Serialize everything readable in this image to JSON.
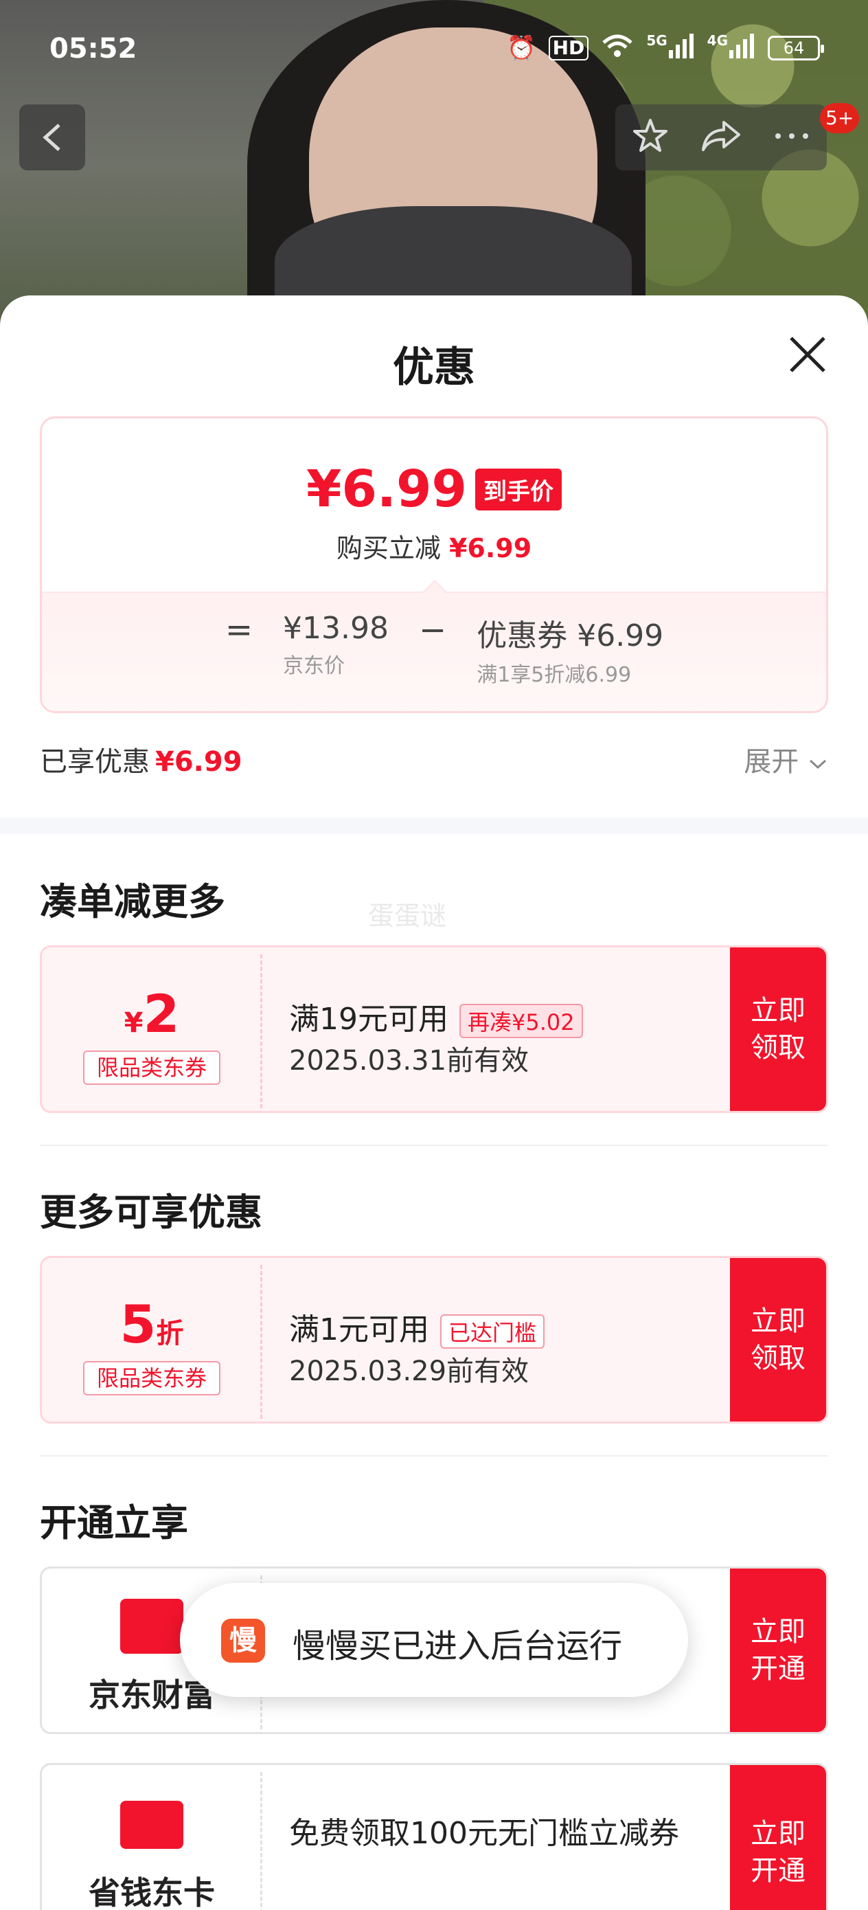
{
  "status_bar": {
    "time": "05:52",
    "hd_label": "HD",
    "net_5g": "5G",
    "net_4g": "4G",
    "battery": "64"
  },
  "nav": {
    "badge": "5+"
  },
  "sheet": {
    "title": "优惠",
    "price_summary": {
      "final_price": "¥6.99",
      "final_price_tag": "到手价",
      "subline_prefix": "购买立减",
      "subline_amount": "¥6.99",
      "equals": "=",
      "jd_price": "¥13.98",
      "jd_price_label": "京东价",
      "minus": "−",
      "coupon_text": "优惠券 ¥6.99",
      "coupon_rule": "满1享5折减6.99"
    },
    "saved_label": "已享优惠",
    "saved_amount": "¥6.99",
    "expand_label": "展开",
    "watermark": "蛋蛋谜"
  },
  "section_more": {
    "title": "凑单减更多",
    "coupon": {
      "symbol": "¥",
      "amount": "2",
      "tag": "限品类东券",
      "condition": "满19元可用",
      "pill": "再凑¥5.02",
      "valid": "2025.03.31前有效",
      "cta_line1": "立即",
      "cta_line2": "领取"
    }
  },
  "section_enjoy": {
    "title": "更多可享优惠",
    "coupon": {
      "amount": "5",
      "unit": "折",
      "tag": "限品类东券",
      "condition": "满1元可用",
      "pill": "已达门槛",
      "valid": "2025.03.29前有效",
      "cta_line1": "立即",
      "cta_line2": "领取"
    }
  },
  "section_open": {
    "title": "开通立享",
    "card1": {
      "brand": "京东财富",
      "cta_line1": "立即",
      "cta_line2": "开通"
    },
    "card2": {
      "brand": "省钱东卡",
      "text": "免费领取100元无门槛立减券",
      "cta_line1": "立即",
      "cta_line2": "开通"
    }
  },
  "toast": {
    "icon_char": "慢",
    "text": "慢慢买已进入后台运行"
  },
  "colors": {
    "accent": "#f2142c",
    "coupon_bg": "#fff4f5",
    "coupon_border": "#ffd6dc"
  }
}
